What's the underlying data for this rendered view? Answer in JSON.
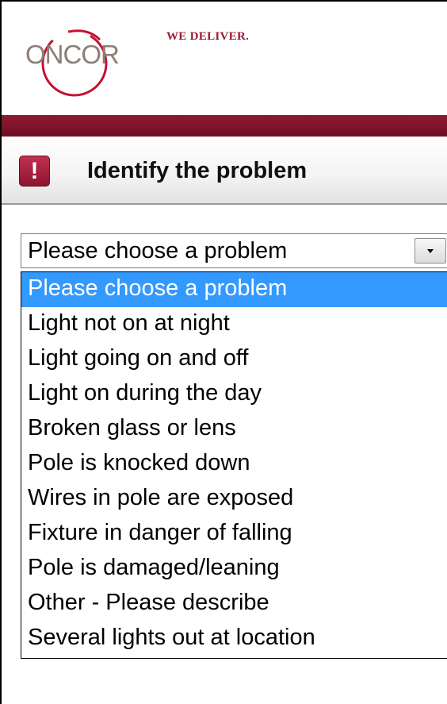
{
  "header": {
    "logo_text": "ONCOR",
    "tagline": "WE DELIVER."
  },
  "section": {
    "icon": "exclamation-icon",
    "icon_glyph": "!",
    "title": "Identify the problem"
  },
  "problem_select": {
    "selected_value": "Please choose a problem",
    "options": [
      "Please choose a problem",
      "Light not on at night",
      "Light going on and off",
      "Light on during the day",
      "Broken glass or lens",
      "Pole is knocked down",
      "Wires in pole are exposed",
      "Fixture in danger of falling",
      "Pole is damaged/leaning",
      "Other - Please describe",
      "Several lights out at location"
    ],
    "highlighted_index": 0
  },
  "colors": {
    "brand": "#8e1a33",
    "highlight": "#3399ff"
  }
}
